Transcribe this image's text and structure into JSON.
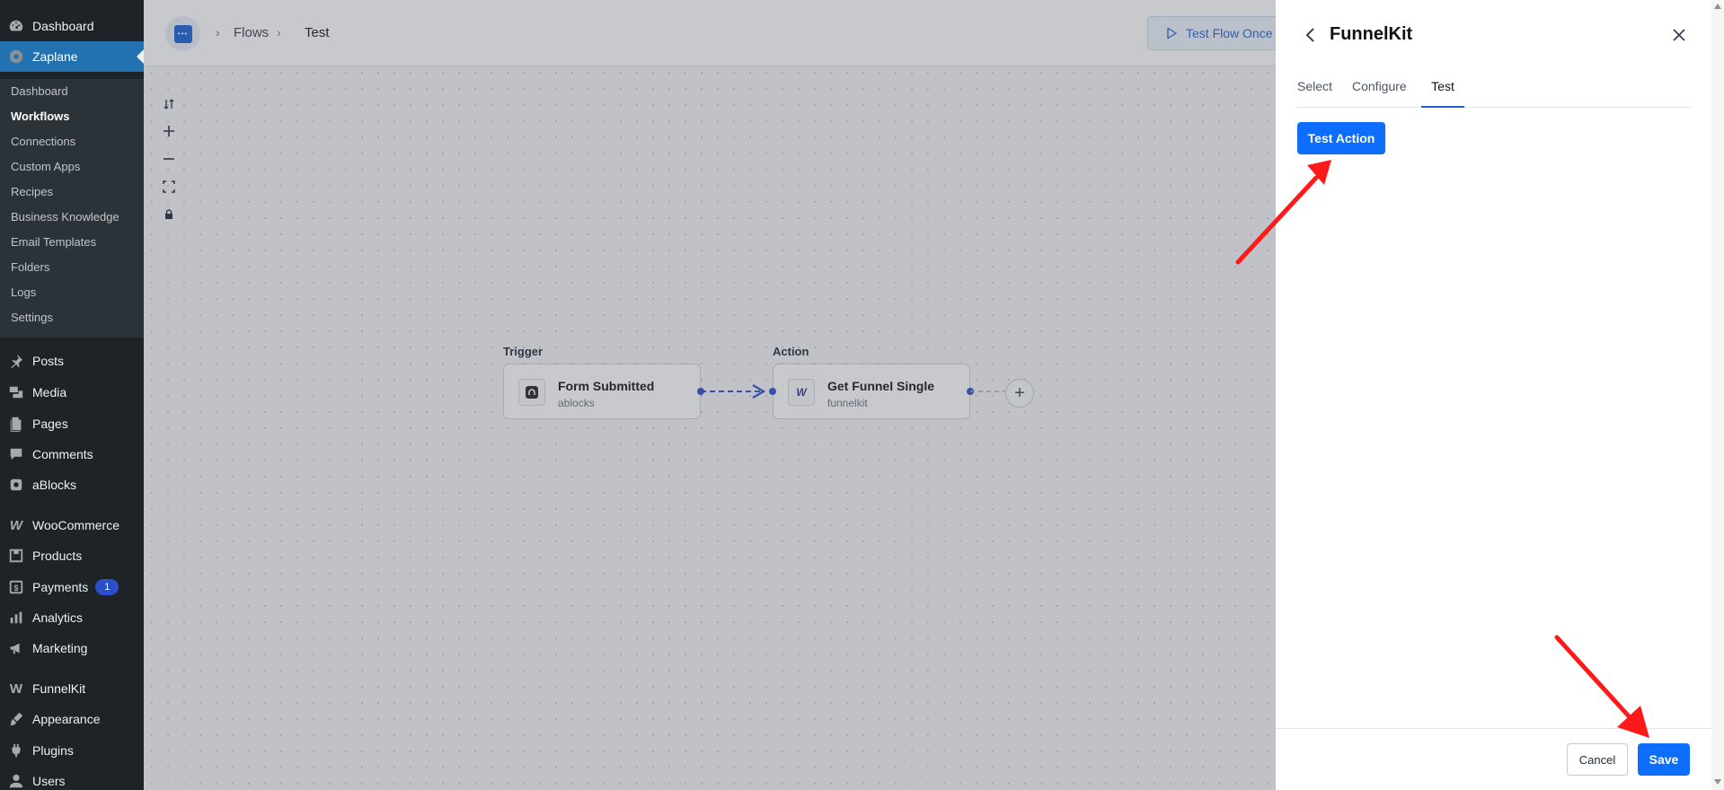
{
  "wp_menu": {
    "dashboard": "Dashboard",
    "plugin": "Zaplane",
    "submenu": [
      "Dashboard",
      "Workflows",
      "Connections",
      "Custom Apps",
      "Recipes",
      "Business Knowledge",
      "Email Templates",
      "Folders",
      "Logs",
      "Settings"
    ],
    "posts": "Posts",
    "media": "Media",
    "pages": "Pages",
    "comments": "Comments",
    "ablocks": "aBlocks",
    "woocommerce": "WooCommerce",
    "products": "Products",
    "payments": "Payments",
    "payments_badge": "1",
    "analytics": "Analytics",
    "marketing": "Marketing",
    "funnelkit": "FunnelKit",
    "appearance": "Appearance",
    "plugins": "Plugins",
    "users": "Users"
  },
  "topbar": {
    "breadcrumb": [
      "Flows",
      "Test"
    ],
    "test_flow_label": "Test Flow Once"
  },
  "flow": {
    "trigger": {
      "label": "Trigger",
      "title": "Form Submitted",
      "app": "ablocks"
    },
    "action": {
      "label": "Action",
      "title": "Get Funnel Single",
      "app": "funnelkit"
    },
    "add_symbol": "+"
  },
  "panel": {
    "title": "FunnelKit",
    "tabs": [
      "Select",
      "Configure",
      "Test"
    ],
    "active_tab": "Test",
    "test_action_label": "Test Action",
    "cancel_label": "Cancel",
    "save_label": "Save"
  },
  "colors": {
    "primary": "#0d6efd",
    "wp_sidebar": "#1d2327",
    "wp_active": "#2271b1",
    "annotation_arrow": "#ff1a1a"
  }
}
